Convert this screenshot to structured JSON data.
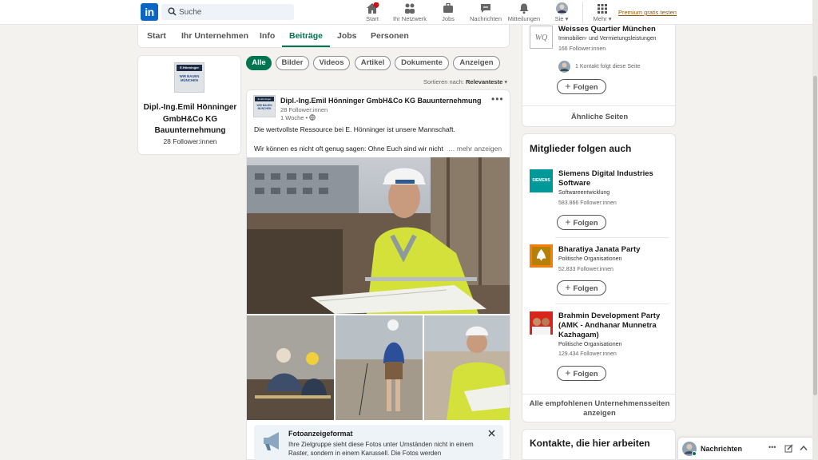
{
  "nav": {
    "search_placeholder": "Suche",
    "items": [
      {
        "label": "Start",
        "icon": "home-icon"
      },
      {
        "label": "Ihr Netzwerk",
        "icon": "network-icon"
      },
      {
        "label": "Jobs",
        "icon": "briefcase-icon"
      },
      {
        "label": "Nachrichten",
        "icon": "message-icon"
      },
      {
        "label": "Mitteilungen",
        "icon": "bell-icon"
      },
      {
        "label": "Sie ▾",
        "icon": "avatar"
      },
      {
        "label": "Mehr ▾",
        "icon": "grid-icon"
      }
    ],
    "premium": "Premium gratis testen",
    "logo": "in"
  },
  "tabs": [
    "Start",
    "Ihr Unternehmen",
    "Info",
    "Beiträge",
    "Jobs",
    "Personen"
  ],
  "company": {
    "logo_top": "E.Hönninger",
    "logo_text": "WIR BAUEN MÜNCHEN",
    "name": "Dipl.-Ing.Emil Hönninger GmbH&Co KG Bauunternehmung",
    "followers": "28 Follower:innen"
  },
  "filters": [
    "Alle",
    "Bilder",
    "Videos",
    "Artikel",
    "Dokumente",
    "Anzeigen"
  ],
  "sort": {
    "label": "Sortieren nach:",
    "value": "Relevanteste"
  },
  "post": {
    "author": "Dipl.-Ing.Emil Hönninger GmbH&Co KG Bauunternehmung",
    "followers": "28 Follower:innen",
    "time": "1 Woche •",
    "text1": "Die wertvollste Ressource bei E. Hönninger ist unsere Mannschaft.",
    "text2": "Wir können es nicht oft genug sagen: Ohne Euch sind wir nicht",
    "more": "… mehr anzeigen"
  },
  "infobox": {
    "title": "Fotoanzeigeformat",
    "text": "Ihre Zielgruppe sieht diese Fotos unter Umständen nicht in einem Raster, sondern in einem Karussell. Die Fotos werden"
  },
  "right_top": {
    "name": "Weisses Quartier München",
    "category": "Immobilien- und Vermietungsleistungen",
    "followers": "166 Follower:innen",
    "contact": "1 Kontakt folgt diese Seite",
    "follow": "Folgen",
    "similar": "Ähnliche Seiten"
  },
  "members_follow": {
    "title": "Mitglieder folgen auch",
    "items": [
      {
        "name": "Siemens Digital Industries Software",
        "category": "Softwareentwicklung",
        "followers": "583.866 Follower:innen",
        "follow": "Folgen",
        "logo": "SIEMENS"
      },
      {
        "name": "Bharatiya Janata Party",
        "category": "Politische Organisationen",
        "followers": "52.833 Follower:innen",
        "follow": "Folgen"
      },
      {
        "name": "Brahmin Development Party (AMK - Andhanar Munnetra Kazhagam)",
        "category": "Politische Organisationen",
        "followers": "129.434 Follower:innen",
        "follow": "Folgen"
      }
    ],
    "all": "Alle empfohlenen Unternehmensseiten anzeigen"
  },
  "contacts_title": "Kontakte, die hier arbeiten",
  "messaging": {
    "label": "Nachrichten",
    "more": "•••"
  },
  "colors": {
    "linkedin_blue": "#0a66c2",
    "green": "#01754f",
    "premium": "#915907",
    "background": "#f4f2ee"
  }
}
